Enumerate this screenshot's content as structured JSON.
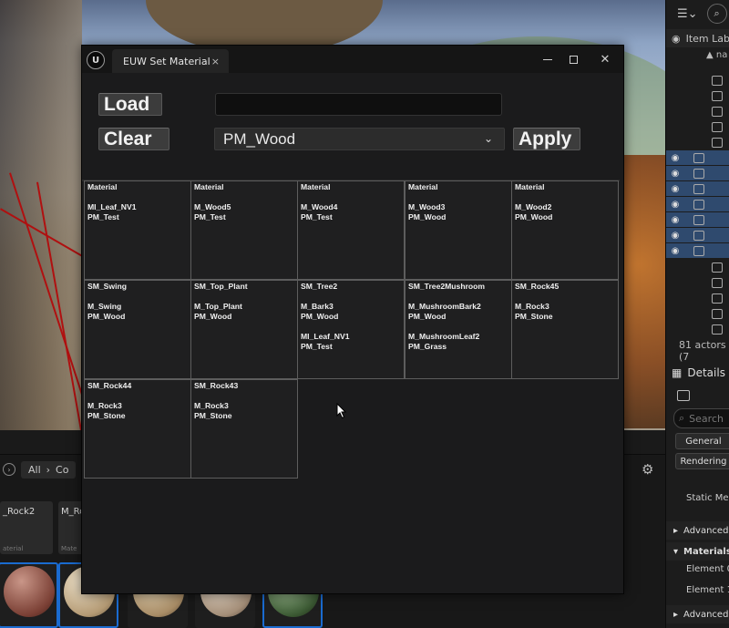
{
  "window": {
    "tab_title": "EUW Set Material",
    "tab_close": "×",
    "logo": "U",
    "minimize_icon": "minimize-icon",
    "close_glyph": "✕"
  },
  "controls": {
    "load_label": "Load",
    "clear_label": "Clear",
    "apply_label": "Apply",
    "text_field_value": "",
    "combo_value": "PM_Wood",
    "combo_chevron": "⌄"
  },
  "grid": {
    "cells": [
      "Material\n\nMI_Leaf_NV1\nPM_Test",
      "Material\n\nM_Wood5\nPM_Test",
      "Material\n\nM_Wood4\nPM_Test",
      "Material\n\nM_Wood3\nPM_Wood",
      "Material\n\nM_Wood2\nPM_Wood",
      "SM_Swing\n\nM_Swing\nPM_Wood",
      "SM_Top_Plant\n\nM_Top_Plant\nPM_Wood",
      "SM_Tree2\n\nM_Bark3\nPM_Wood\n\nMI_Leaf_NV1\nPM_Test",
      "SM_Tree2Mushroom\n\nM_MushroomBark2\nPM_Wood\n\nM_MushroomLeaf2\nPM_Grass",
      "SM_Rock45\n\nM_Rock3\nPM_Stone",
      "SM_Rock44\n\nM_Rock3\nPM_Stone",
      "SM_Rock43\n\nM_Rock3\nPM_Stone"
    ]
  },
  "content_browser": {
    "crumb_all": "All",
    "crumb_next": "Co",
    "crumb_arrow": "›",
    "tiles": [
      {
        "name": "_Rock2",
        "type": "aterial"
      },
      {
        "name": "M_Ro",
        "type": "Mate"
      }
    ],
    "gear": "⚙"
  },
  "outliner": {
    "filter_icon": "☰⌄",
    "header_label": "Item Lab",
    "sub_header": "na",
    "actor_count": "81 actors (7",
    "eye_glyph": "◉"
  },
  "details": {
    "title": "Details",
    "search_placeholder": "Search",
    "chip_general": "General",
    "chip_rendering": "Rendering",
    "static_mesh_label": "Static Mes",
    "section_advanced": "Advanced",
    "section_materials": "Materials",
    "element0": "Element 0",
    "element1": "Element 1",
    "section_advanced2": "Advanced"
  }
}
